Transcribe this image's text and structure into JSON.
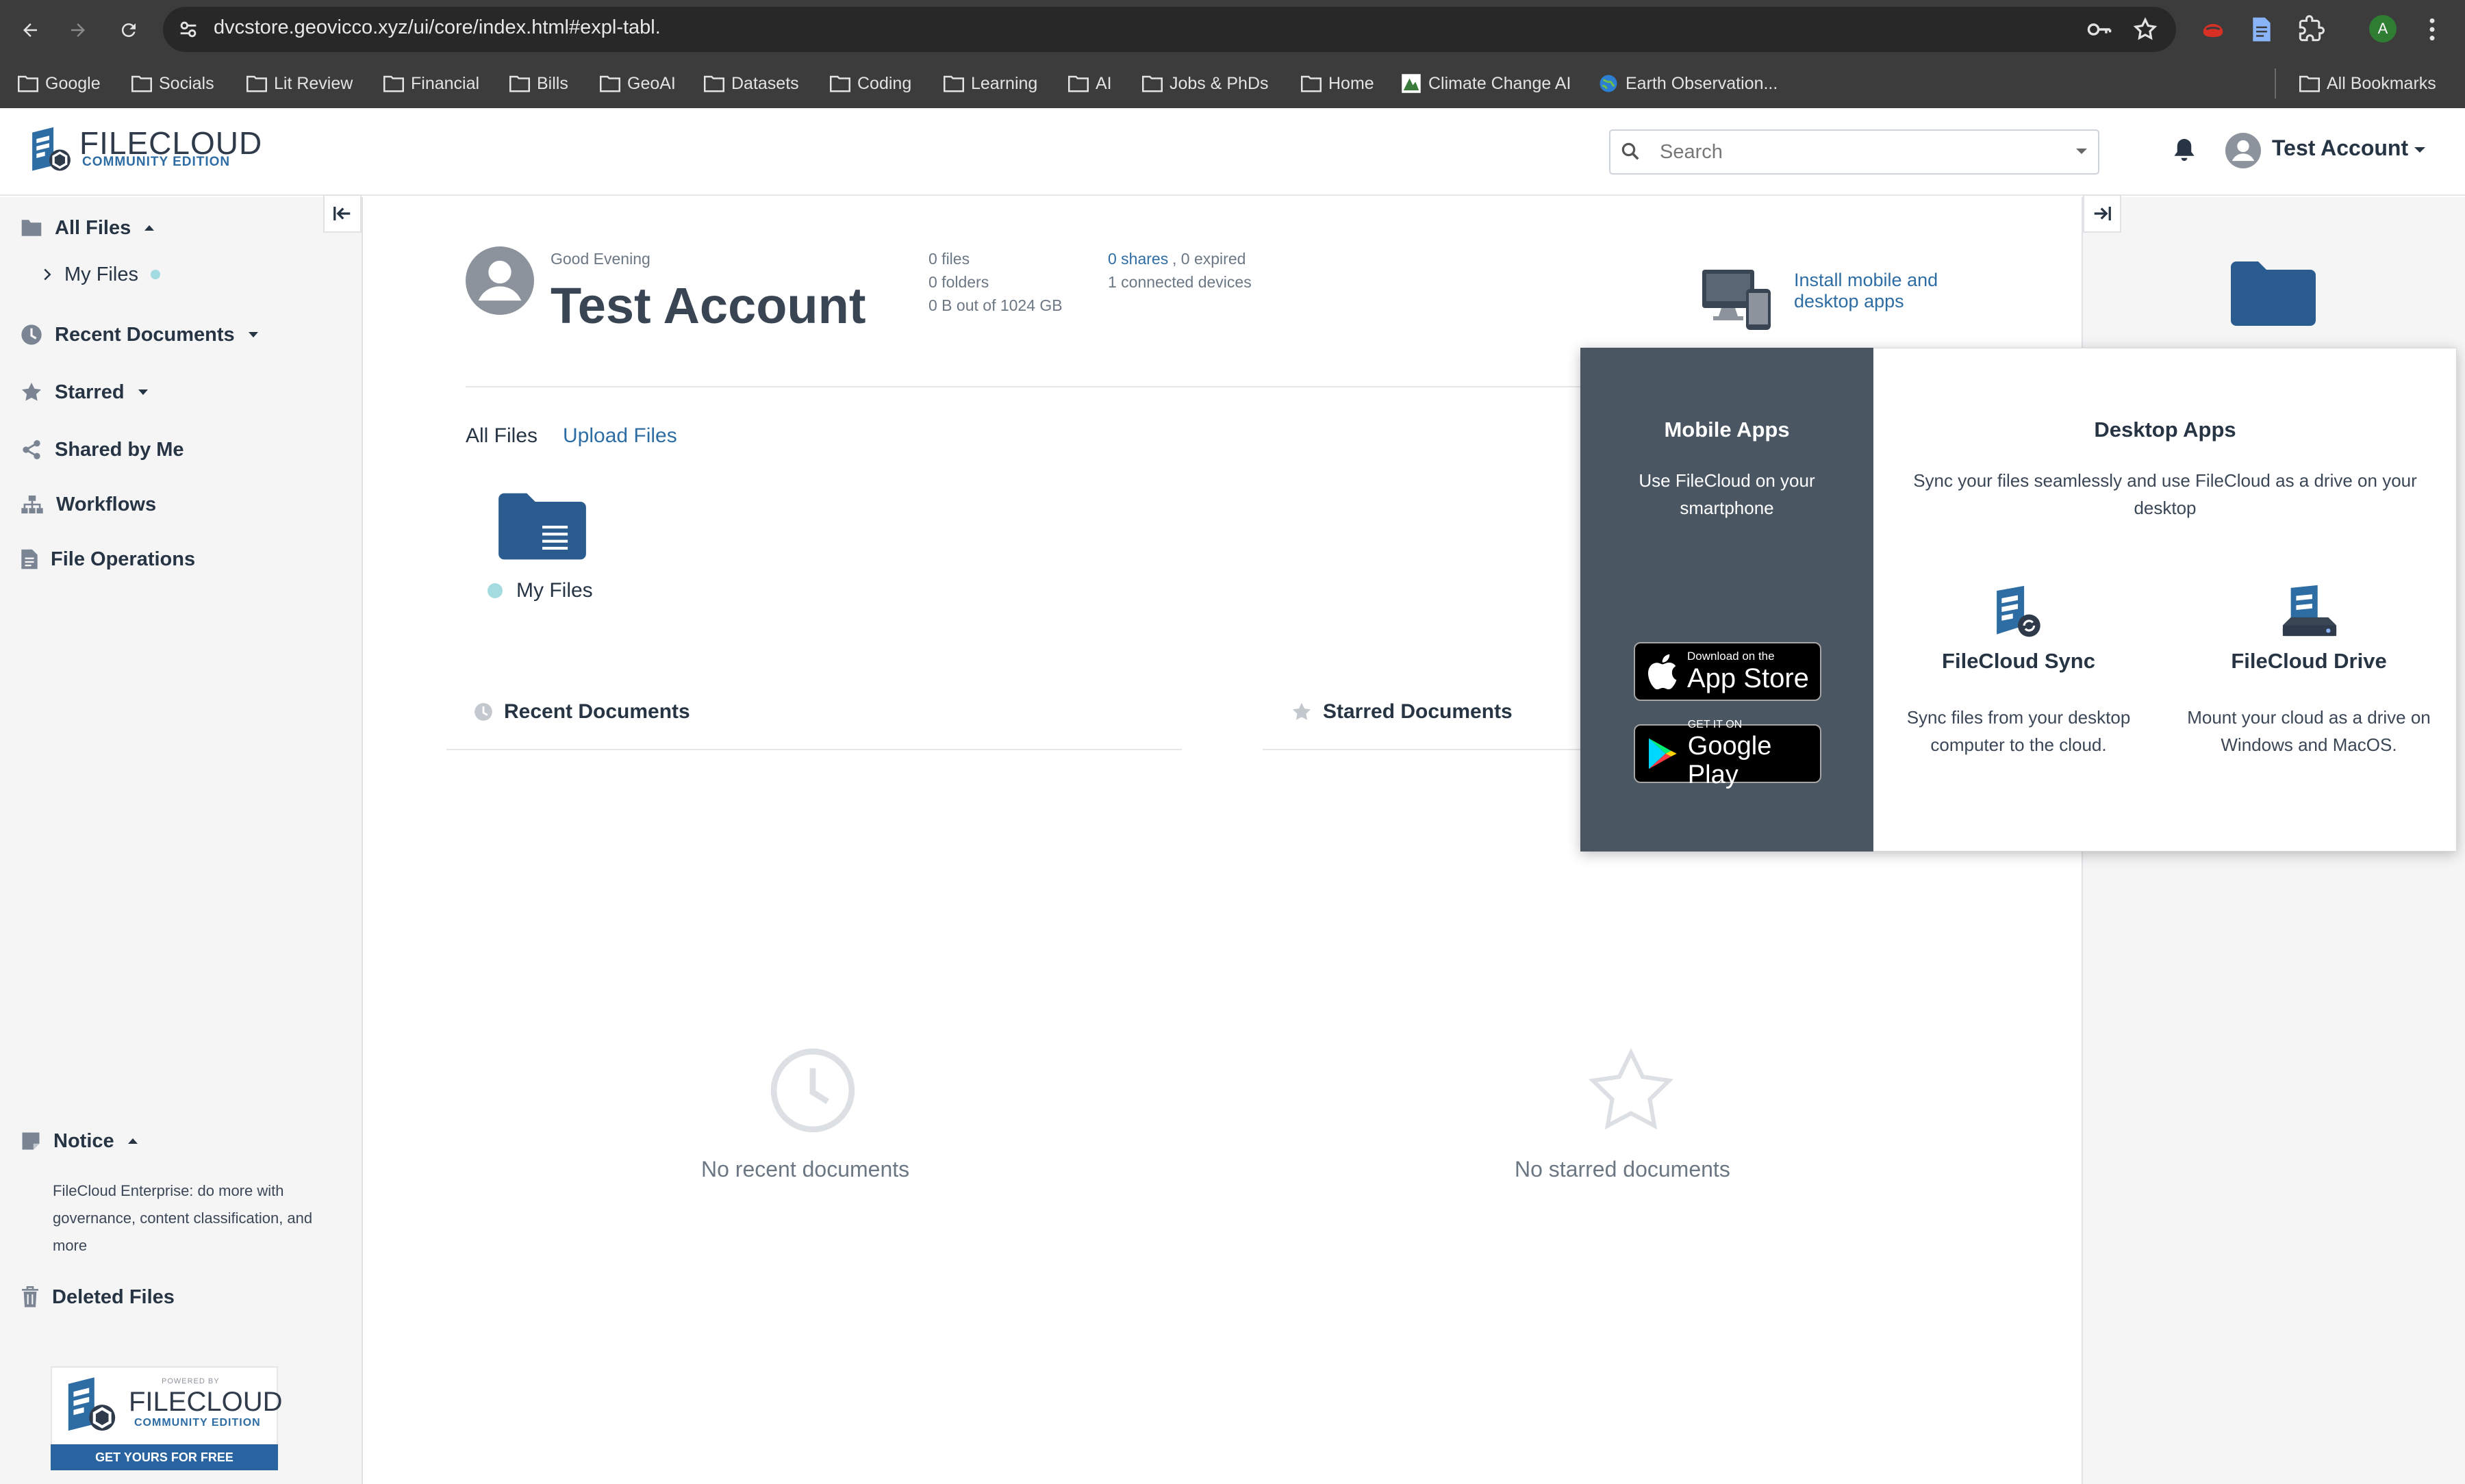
{
  "browser": {
    "url": "dvcstore.geovicco.xyz/ui/core/index.html#expl-tabl.",
    "bookmarks": [
      "Google",
      "Socials",
      "Lit Review",
      "Financial",
      "Bills",
      "GeoAI",
      "Datasets",
      "Coding",
      "Learning",
      "AI",
      "Jobs & PhDs",
      "Home",
      "Climate Change AI",
      "Earth Observation..."
    ],
    "all_bookmarks": "All Bookmarks",
    "profile_initial": "A"
  },
  "header": {
    "logo_main": "FILECLOUD",
    "logo_sub": "COMMUNITY EDITION",
    "search_placeholder": "Search",
    "account_name": "Test Account"
  },
  "sidebar": {
    "all_files": "All Files",
    "my_files": "My Files",
    "recent_documents": "Recent Documents",
    "starred": "Starred",
    "shared_by_me": "Shared by Me",
    "workflows": "Workflows",
    "file_operations": "File Operations",
    "notice_title": "Notice",
    "notice_text": "FileCloud Enterprise: do more with governance, content classification, and more",
    "deleted_files": "Deleted Files",
    "promo": {
      "powered_by": "POWERED BY",
      "logo_main": "FILECLOUD",
      "logo_sub": "COMMUNITY EDITION",
      "cta": "GET YOURS FOR FREE"
    }
  },
  "main": {
    "greeting": "Good Evening",
    "name": "Test Account",
    "stats": {
      "files": "0 files",
      "folders": "0 folders",
      "storage": "0 B out of 1024 GB",
      "shares_link": "0 shares",
      "expired": ", 0 expired",
      "devices": "1 connected devices"
    },
    "install_label": "Install mobile and desktop apps",
    "tabs": {
      "all_files": "All Files",
      "upload_files": "Upload Files"
    },
    "folder_name": "My Files",
    "recent_title": "Recent Documents",
    "starred_title": "Starred Documents",
    "no_recent": "No recent documents",
    "no_starred": "No starred documents"
  },
  "popup": {
    "mobile_title": "Mobile Apps",
    "mobile_desc": "Use FileCloud on your smartphone",
    "appstore_small": "Download on the",
    "appstore_big": "App Store",
    "googleplay_small": "GET IT ON",
    "googleplay_big": "Google Play",
    "desktop_title": "Desktop Apps",
    "desktop_desc": "Sync your files seamlessly and use FileCloud as a drive on your desktop",
    "sync_title": "FileCloud Sync",
    "sync_desc": "Sync files from your desktop computer to the cloud.",
    "drive_title": "FileCloud Drive",
    "drive_desc": "Mount your cloud as a drive on Windows and MacOS."
  },
  "colors": {
    "brand_blue": "#2e6da4",
    "folder_blue": "#2b5c8f",
    "status_dot": "#a3dbe0",
    "popup_dark": "#4b5663"
  }
}
